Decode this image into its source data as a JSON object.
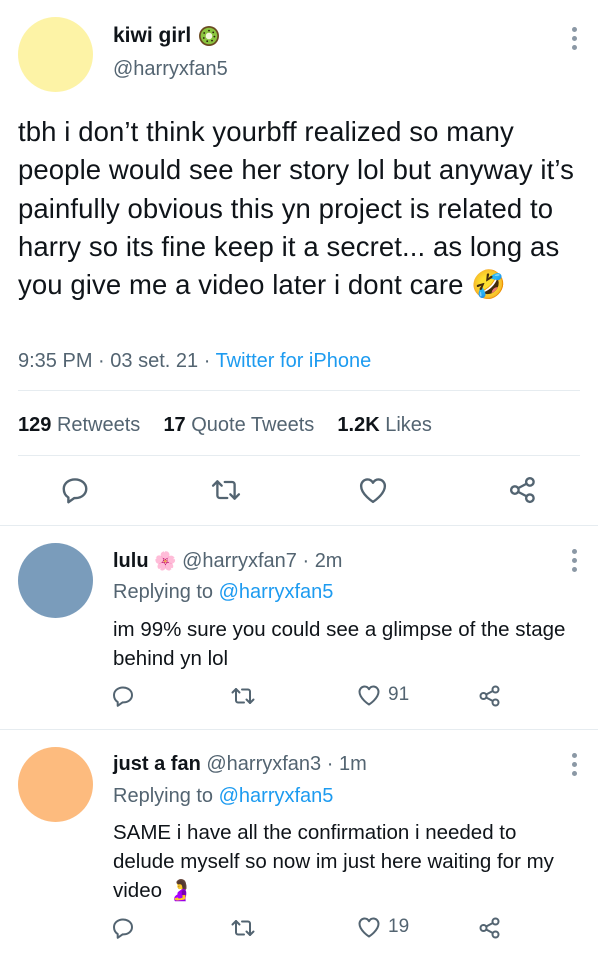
{
  "main_tweet": {
    "display_name": "kiwi girl",
    "handle": "@harryxfan5",
    "text": "tbh i don’t think yourbff realized so many people would see her story lol but anyway it’s painfully obvious this yn project is related to harry so its fine keep it a secret... as long as you give me a video later i dont care",
    "emoji": "🤣",
    "time": "9:35 PM",
    "date": "03 set. 21",
    "source": "Twitter for iPhone",
    "sep": "·",
    "stats": {
      "retweets_count": "129",
      "retweets_label": "Retweets",
      "quotes_count": "17",
      "quotes_label": "Quote Tweets",
      "likes_count": "1.2K",
      "likes_label": "Likes"
    },
    "avatar_color": "#fdf3a6"
  },
  "replies": [
    {
      "display_name": "lulu",
      "name_emoji": "🌸",
      "handle": "@harryxfan7",
      "time": "2m",
      "replying_label": "Replying to",
      "replying_to": "@harryxfan5",
      "text": "im 99% sure you could see a glimpse of the stage behind yn lol",
      "likes": "91",
      "avatar_color": "#7a9cbb"
    },
    {
      "display_name": "just a fan",
      "handle": "@harryxfan3",
      "time": "1m",
      "replying_label": "Replying to",
      "replying_to": "@harryxfan5",
      "text": "SAME i have all the confirmation i needed to delude myself so now im just here waiting for my video",
      "emoji": "🤰",
      "likes": "19",
      "avatar_color": "#fdbb7e"
    }
  ],
  "icons": [
    "kiwi-badge-icon",
    "more-icon",
    "reply-icon",
    "retweet-icon",
    "like-icon",
    "share-icon"
  ],
  "colors": {
    "link": "#1d9bf0",
    "secondary_text": "#536471",
    "divider": "#e6ecf0"
  }
}
